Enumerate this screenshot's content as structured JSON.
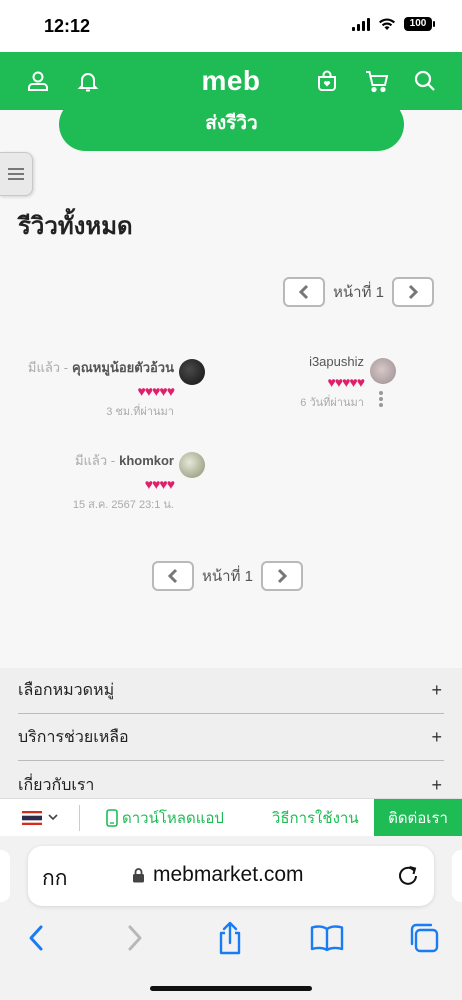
{
  "status_bar": {
    "time": "12:12",
    "battery": "100"
  },
  "app": {
    "logo": "meb"
  },
  "content": {
    "submit_review_label": "ส่งรีวิว",
    "section_title": "รีวิวทั้งหมด",
    "pager_top": {
      "label": "หน้าที่ 1"
    },
    "pager_bottom": {
      "label": "หน้าที่ 1"
    },
    "reviews": [
      {
        "status": "มีแล้ว -",
        "username": "คุณหมูน้อยตัวอ้วน",
        "hearts": "♥♥♥♥♥",
        "time": "3 ชม.ที่ผ่านมา"
      },
      {
        "status": "",
        "username": "i3apushiz",
        "hearts": "♥♥♥♥♥",
        "time": "6 วันที่ผ่านมา"
      },
      {
        "status": "มีแล้ว -",
        "username": "khomkor",
        "hearts": "♥♥♥♥",
        "time": "15 ส.ค. 2567 23:1 น."
      }
    ]
  },
  "footer": {
    "items": [
      {
        "label": "เลือกหมวดหมู่",
        "icon": "+"
      },
      {
        "label": "บริการช่วยเหลือ",
        "icon": "+"
      },
      {
        "label": "เกี่ยวกับเรา",
        "icon": "+"
      }
    ]
  },
  "bottom_bar": {
    "download_app": "ดาวน์โหลดแอป",
    "how_to": "วิธีการใช้งาน",
    "contact": "ติดต่อเรา"
  },
  "browser": {
    "aa_label": "กก",
    "url": "mebmarket.com"
  },
  "colors": {
    "brand_green": "#1fbc55",
    "heart_pink": "#e01e6a"
  }
}
